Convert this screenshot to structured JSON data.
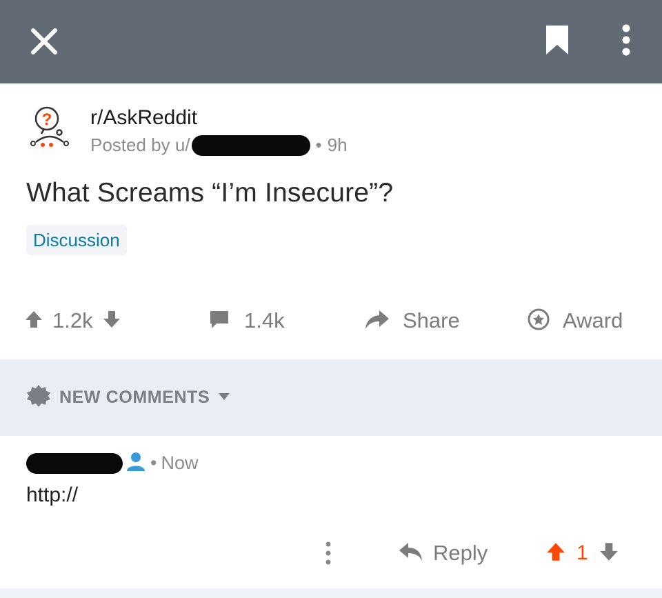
{
  "topbar": {
    "close_icon": "close-icon",
    "bookmark_icon": "bookmark-icon",
    "more_icon": "more-vertical-icon",
    "background": "#626b73"
  },
  "post": {
    "subreddit": "r/AskReddit",
    "posted_by_prefix": "Posted by u/",
    "age": "9h",
    "title": "What Screams “I’m Insecure”?",
    "flair": "Discussion",
    "upvotes": "1.2k",
    "comments": "1.4k",
    "share_label": "Share",
    "award_label": "Award"
  },
  "comments_sort": {
    "label": "NEW COMMENTS"
  },
  "comment": {
    "time": "Now",
    "body": "http://",
    "reply_label": "Reply",
    "score": "1",
    "upvote_color": "#ff4500"
  },
  "colors": {
    "flair_text": "#0a7ca6",
    "muted": "#8c8c8c",
    "band": "#e9edf4",
    "user_icon": "#3a9ad9"
  }
}
